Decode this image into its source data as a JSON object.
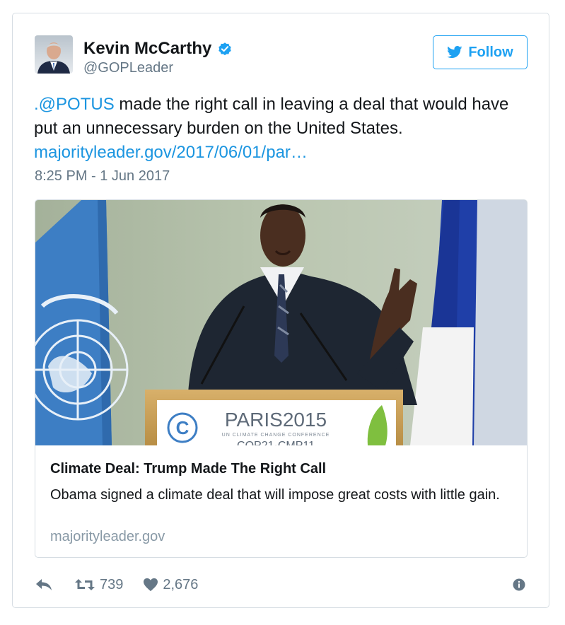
{
  "author": {
    "name": "Kevin McCarthy",
    "handle": "@GOPLeader",
    "verified": true
  },
  "follow_button": {
    "label": "Follow",
    "icon": "twitter-bird-icon"
  },
  "tweet": {
    "mention": ".@POTUS",
    "text_body": " made the right call in leaving a deal that would have put an unnecessary burden on the United States.",
    "link": "majorityleader.gov/2017/06/01/par…",
    "timestamp": "8:25 PM - 1 Jun 2017"
  },
  "card": {
    "image_banner_text": "PARIS2015",
    "image_banner_subtitle": "UN CLIMATE CHANGE CONFERENCE",
    "image_banner_partial": "COP21·CMP11",
    "title": "Climate Deal: Trump Made The Right Call",
    "description": "Obama signed a climate deal that will impose great costs with little gain.",
    "domain": "majorityleader.gov"
  },
  "actions": {
    "reply_icon": "reply-icon",
    "retweet_icon": "retweet-icon",
    "retweet_count": "739",
    "like_icon": "heart-icon",
    "like_count": "2,676",
    "info_icon": "info-icon"
  },
  "colors": {
    "accent": "#1da1f2",
    "link": "#1b95e0",
    "text": "#14171a",
    "secondary_text": "#657786",
    "border": "#d6dde3"
  }
}
